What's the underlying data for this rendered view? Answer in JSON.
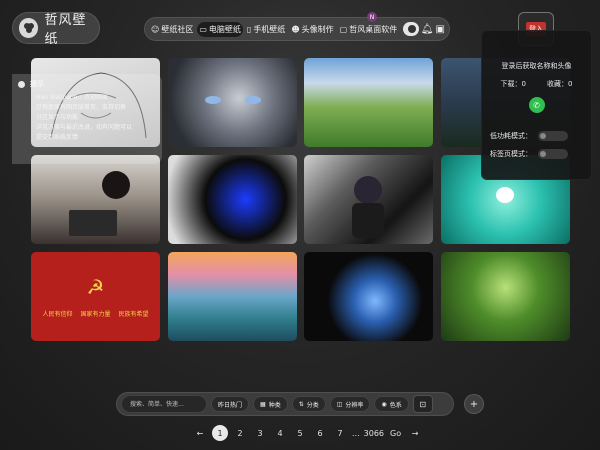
{
  "app": {
    "title": "哲风壁纸"
  },
  "topnav": {
    "items": [
      {
        "label": "壁纸社区",
        "icon": "community-icon"
      },
      {
        "label": "电脑壁纸",
        "icon": "monitor-icon"
      },
      {
        "label": "手机壁纸",
        "icon": "phone-icon"
      },
      {
        "label": "头像制作",
        "icon": "avatar-icon"
      },
      {
        "label": "哲风桌面软件",
        "icon": "desktop-icon"
      }
    ],
    "badge": "N"
  },
  "login": {
    "label": "登入"
  },
  "tip": {
    "title": "提示",
    "lines": [
      "Hao Wallpaper! 欢迎回家",
      "已恢复原有网页版首页，支持切换",
      "分区显示与功能",
      "详见方案与最近改进，如有问题可以",
      "提交到系统反馈"
    ]
  },
  "user_panel": {
    "prompt": "登录后获取名称和头像",
    "downloads_label": "下载：0",
    "favorites_label": "收藏：0",
    "low_power_label": "低功耗模式：",
    "tab_mode_label": "标签页模式："
  },
  "gallery": {
    "slogans": [
      "人民有信仰",
      "国家有力量",
      "民族有希望"
    ]
  },
  "toolbar": {
    "search_placeholder": "搜索、简单、快速…",
    "hot": "昨日热门",
    "category": "种类",
    "sort": "分类",
    "resolution": "分辨率",
    "color": "色系"
  },
  "pagination": {
    "prev": "←",
    "pages": [
      "1",
      "2",
      "3",
      "4",
      "5",
      "6",
      "7"
    ],
    "ellipsis": "...",
    "last": "3066",
    "go": "Go",
    "next": "→"
  },
  "colors": {
    "accent_red": "#b5201c",
    "wechat_green": "#2fbf4f"
  }
}
